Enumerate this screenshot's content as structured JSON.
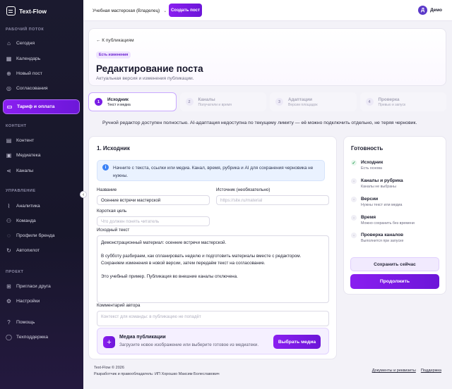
{
  "app": {
    "name": "Text-Flow"
  },
  "sidebar": {
    "sections": [
      {
        "title": "РАБОЧИЙ ПОТОК",
        "items": [
          {
            "label": "Сегодня",
            "icon": "home-icon"
          },
          {
            "label": "Календарь",
            "icon": "calendar-icon"
          },
          {
            "label": "Новый пост",
            "icon": "plus-circle-icon"
          },
          {
            "label": "Согласования",
            "icon": "check-circle-icon"
          },
          {
            "label": "Тариф и оплата",
            "icon": "card-icon",
            "active": true
          }
        ]
      },
      {
        "title": "КОНТЕНТ",
        "items": [
          {
            "label": "Контент",
            "icon": "grid-icon"
          },
          {
            "label": "Медиатека",
            "icon": "image-icon"
          },
          {
            "label": "Каналы",
            "icon": "share-icon"
          }
        ]
      },
      {
        "title": "УПРАВЛЕНИЕ",
        "items": [
          {
            "label": "Аналитика",
            "icon": "chart-icon"
          },
          {
            "label": "Команда",
            "icon": "team-icon"
          },
          {
            "label": "Профили бренда",
            "icon": "profile-icon"
          },
          {
            "label": "Автопилот",
            "icon": "autopilot-icon"
          }
        ]
      },
      {
        "title": "ПРОЕКТ",
        "items": [
          {
            "label": "Пригласи друга",
            "icon": "gift-icon"
          },
          {
            "label": "Настройки",
            "icon": "gear-icon"
          }
        ]
      },
      {
        "title": "",
        "items": [
          {
            "label": "Помощь",
            "icon": "help-icon"
          },
          {
            "label": "Техподдержка",
            "icon": "chat-icon"
          }
        ]
      }
    ]
  },
  "topbar": {
    "workspace": "Учебная мастерская (Владелец)",
    "create_button": "Создать пост",
    "user_initial": "Д",
    "user_name": "Демо"
  },
  "header": {
    "back": "← К публикациям",
    "badge": "Есть изменения",
    "title": "Редактирование поста",
    "subtitle": "Актуальная версия и изменения публикации."
  },
  "steps": [
    {
      "num": "1",
      "title": "Исходник",
      "subtitle": "Текст и медиа",
      "active": true
    },
    {
      "num": "2",
      "title": "Каналы",
      "subtitle": "Получатели и время",
      "active": false
    },
    {
      "num": "3",
      "title": "Адаптации",
      "subtitle": "Версии площадок",
      "active": false
    },
    {
      "num": "4",
      "title": "Проверка",
      "subtitle": "Превью и запуск",
      "active": false
    }
  ],
  "notice": "Ручной редактор доступен полностью. AI-адаптация недоступна по текущему лимиту — её можно подключить отдельно, не теряя черновик.",
  "form": {
    "title": "1. Исходник",
    "info": "Начните с текста, ссылки или медиа. Канал, время, рубрика и AI для сохранения черновика не нужны.",
    "name_label": "Название",
    "name_value": "Осенние встречи мастерской",
    "source_label": "Источник (необязательно)",
    "source_placeholder": "https://site.ru/material",
    "goal_label": "Короткая цель",
    "goal_placeholder": "Что должен понять читатель",
    "text_label": "Исходный текст",
    "text_paragraphs": [
      "Демонстрационный материал: осенние встречи мастерской.",
      "В субботу разбираем, как спланировать неделю и подготовить материалы вместе с редактором. Сохраняем изменения в новой версии, затем передаём текст на согласование.",
      "Это учебный пример. Публикация во внешние каналы отключена."
    ],
    "comment_label": "Комментарий автора",
    "comment_placeholder": "Контекст для команды: в публикацию не попадёт",
    "media_title": "Медиа публикации",
    "media_subtitle": "Загрузите новое изображение или выберите готовое из медиатеки.",
    "media_button": "Выбрать медиа"
  },
  "readiness": {
    "title": "Готовность",
    "items": [
      {
        "title": "Исходник",
        "subtitle": "Есть основа",
        "done": true
      },
      {
        "title": "Каналы и рубрика",
        "subtitle": "Каналы не выбраны",
        "done": false
      },
      {
        "title": "Версии",
        "subtitle": "Нужны текст или медиа",
        "done": false
      },
      {
        "title": "Время",
        "subtitle": "Можно сохранить без времени",
        "done": false
      },
      {
        "title": "Проверка каналов",
        "subtitle": "Выполнится при запуске",
        "done": false
      }
    ],
    "save_button": "Сохранить сейчас",
    "continue_button": "Продолжить"
  },
  "footer": {
    "copyright": "Text-Flow © 2026",
    "developer": "Разработчик и правообладатель: ИП Хорошко Максим Болеславович",
    "links": [
      "Документы и реквизиты",
      "Поддержка"
    ]
  }
}
